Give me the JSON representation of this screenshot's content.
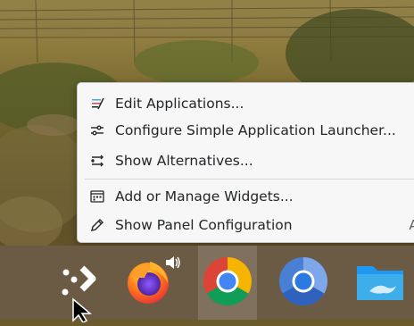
{
  "menu": {
    "items": [
      {
        "label": "Edit Applications...",
        "icon": "edit-applications-icon"
      },
      {
        "label": "Configure Simple Application Launcher...",
        "icon": "configure-sliders-icon"
      },
      {
        "label": "Show Alternatives...",
        "icon": "alternatives-icon"
      },
      {
        "label": "Add or Manage Widgets...",
        "icon": "widgets-icon"
      },
      {
        "label": "Show Panel Configuration",
        "icon": "pencil-icon",
        "shortcut": "A"
      }
    ]
  },
  "panel": {
    "launcher_icon": "application-launcher-icon",
    "tasks": [
      {
        "name": "Firefox",
        "icon": "firefox-icon",
        "badge": "speaker-icon"
      },
      {
        "name": "Google Chrome",
        "icon": "chrome-icon"
      },
      {
        "name": "Chromium",
        "icon": "chromium-icon"
      },
      {
        "name": "Dolphin",
        "icon": "folder-icon"
      }
    ]
  },
  "colors": {
    "menu_bg": "#f7f7f7",
    "panel_bg": "#6b5a44",
    "menu_text": "#232629"
  }
}
